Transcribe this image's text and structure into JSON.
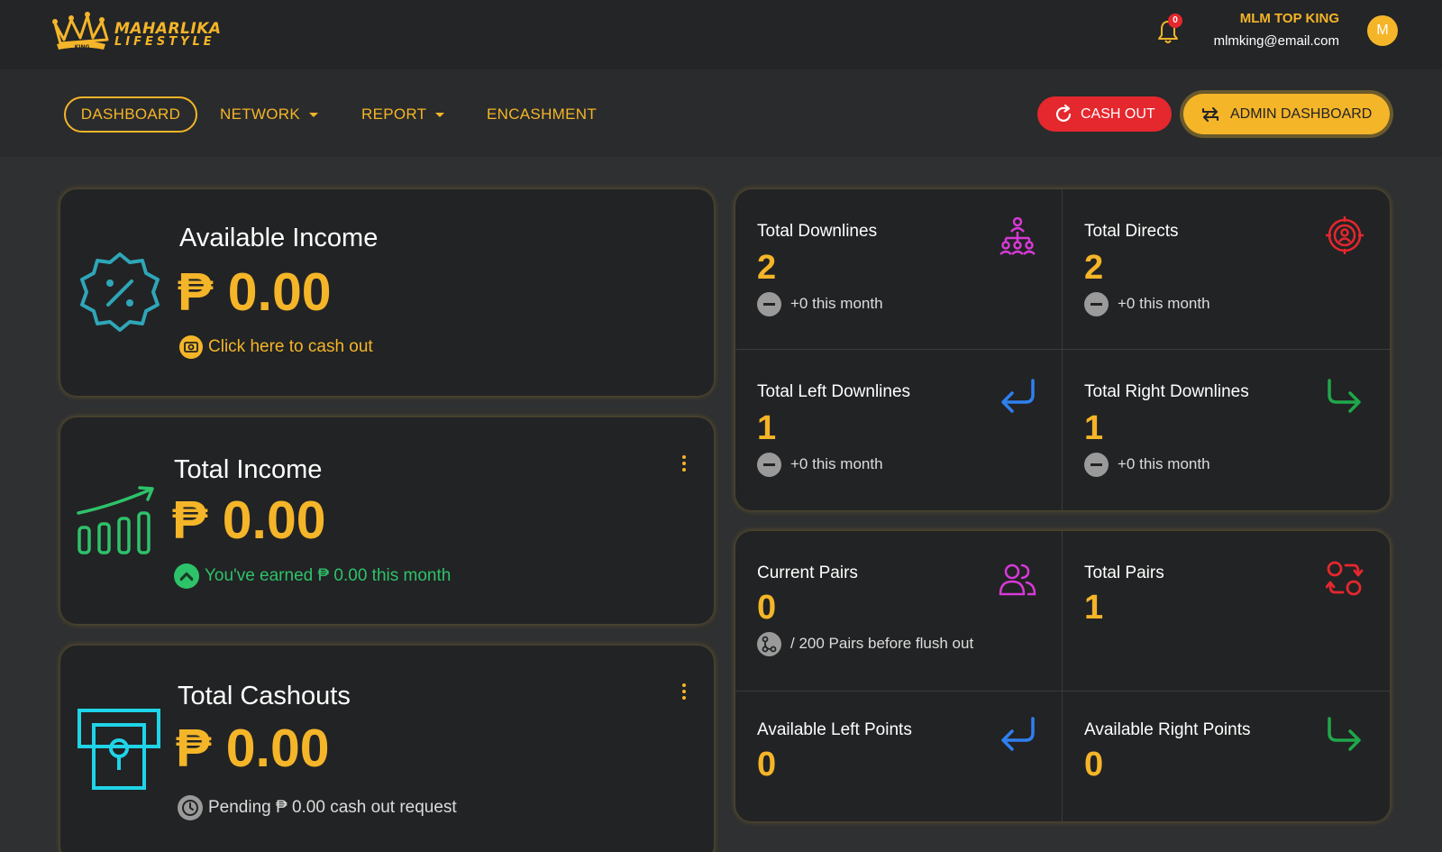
{
  "header": {
    "logo_line1": "MAHARLIKA",
    "logo_line2": "LIFESTYLE",
    "logo_crown_text": "KING",
    "notification_count": "0",
    "user_name": "MLM TOP KING",
    "user_email": "mlmking@email.com",
    "avatar_initial": "M"
  },
  "nav": {
    "dashboard": "DASHBOARD",
    "network": "NETWORK",
    "report": "REPORT",
    "encashment": "ENCASHMENT",
    "cash_out": "CASH OUT",
    "admin_dashboard": "ADMIN DASHBOARD"
  },
  "income_cards": [
    {
      "title": "Available Income",
      "value": "₱ 0.00",
      "note": "Click here to cash out",
      "icon": "discount-badge-icon"
    },
    {
      "title": "Total Income",
      "value": "₱ 0.00",
      "note": "You've earned ₱ 0.00 this month",
      "icon": "growth-chart-icon"
    },
    {
      "title": "Total Cashouts",
      "value": "₱ 0.00",
      "note": "Pending ₱ 0.00 cash out request",
      "icon": "atm-withdraw-icon"
    }
  ],
  "downline_stats": [
    {
      "label": "Total Downlines",
      "value": "2",
      "sub": "+0 this month",
      "icon": "hierarchy-icon"
    },
    {
      "label": "Total Directs",
      "value": "2",
      "sub": "+0 this month",
      "icon": "target-user-icon"
    },
    {
      "label": "Total Left Downlines",
      "value": "1",
      "sub": "+0 this month",
      "icon": "arrow-left-turn-icon"
    },
    {
      "label": "Total Right Downlines",
      "value": "1",
      "sub": "+0 this month",
      "icon": "arrow-right-turn-icon"
    }
  ],
  "pair_stats": [
    {
      "label": "Current Pairs",
      "value": "0",
      "sub": "/ 200 Pairs before flush out",
      "icon": "users-icon"
    },
    {
      "label": "Total Pairs",
      "value": "1",
      "icon": "exchange-circles-icon"
    },
    {
      "label": "Available Left Points",
      "value": "0",
      "icon": "arrow-left-turn-icon"
    },
    {
      "label": "Available Right Points",
      "value": "0",
      "icon": "arrow-right-turn-icon"
    }
  ],
  "colors": {
    "accent": "#f4b529",
    "danger": "#e5272e",
    "success": "#2ec26a",
    "card_bg": "#222324",
    "page_bg": "#2f3031"
  }
}
